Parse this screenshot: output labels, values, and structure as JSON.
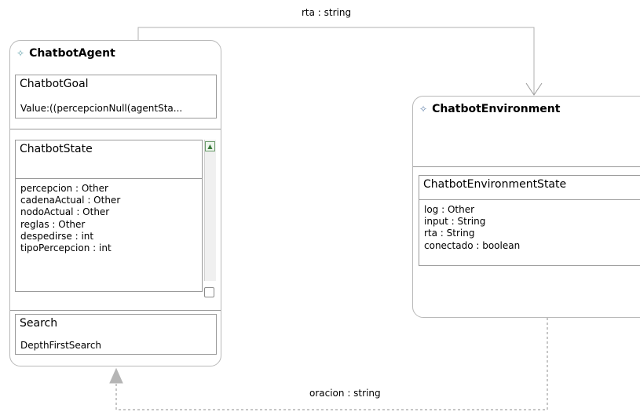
{
  "diagram": {
    "agent": {
      "name": "ChatbotAgent",
      "icon": "diamond-icon",
      "goal": {
        "title": "ChatbotGoal",
        "value": "Value:((percepcionNull(agentSta..."
      },
      "state": {
        "title": "ChatbotState",
        "attributes": [
          "percepcion : Other",
          "cadenaActual : Other",
          "nodoActual : Other",
          "reglas : Other",
          "despedirse : int",
          "tipoPercepcion : int"
        ]
      },
      "search": {
        "title": "Search",
        "value": "DepthFirstSearch"
      }
    },
    "environment": {
      "name": "ChatbotEnvironment",
      "icon": "diamond-icon",
      "state": {
        "title": "ChatbotEnvironmentState",
        "attributes": [
          "log : Other",
          "input : String",
          "rta : String",
          "conectado : boolean"
        ]
      }
    },
    "connections": {
      "top_label": "rta : string",
      "bottom_label": "oracion : string"
    },
    "colors": {
      "border": "#b9b9b9",
      "line": "#8c8c8c",
      "arrow_fill": "#b5b5b5"
    }
  }
}
